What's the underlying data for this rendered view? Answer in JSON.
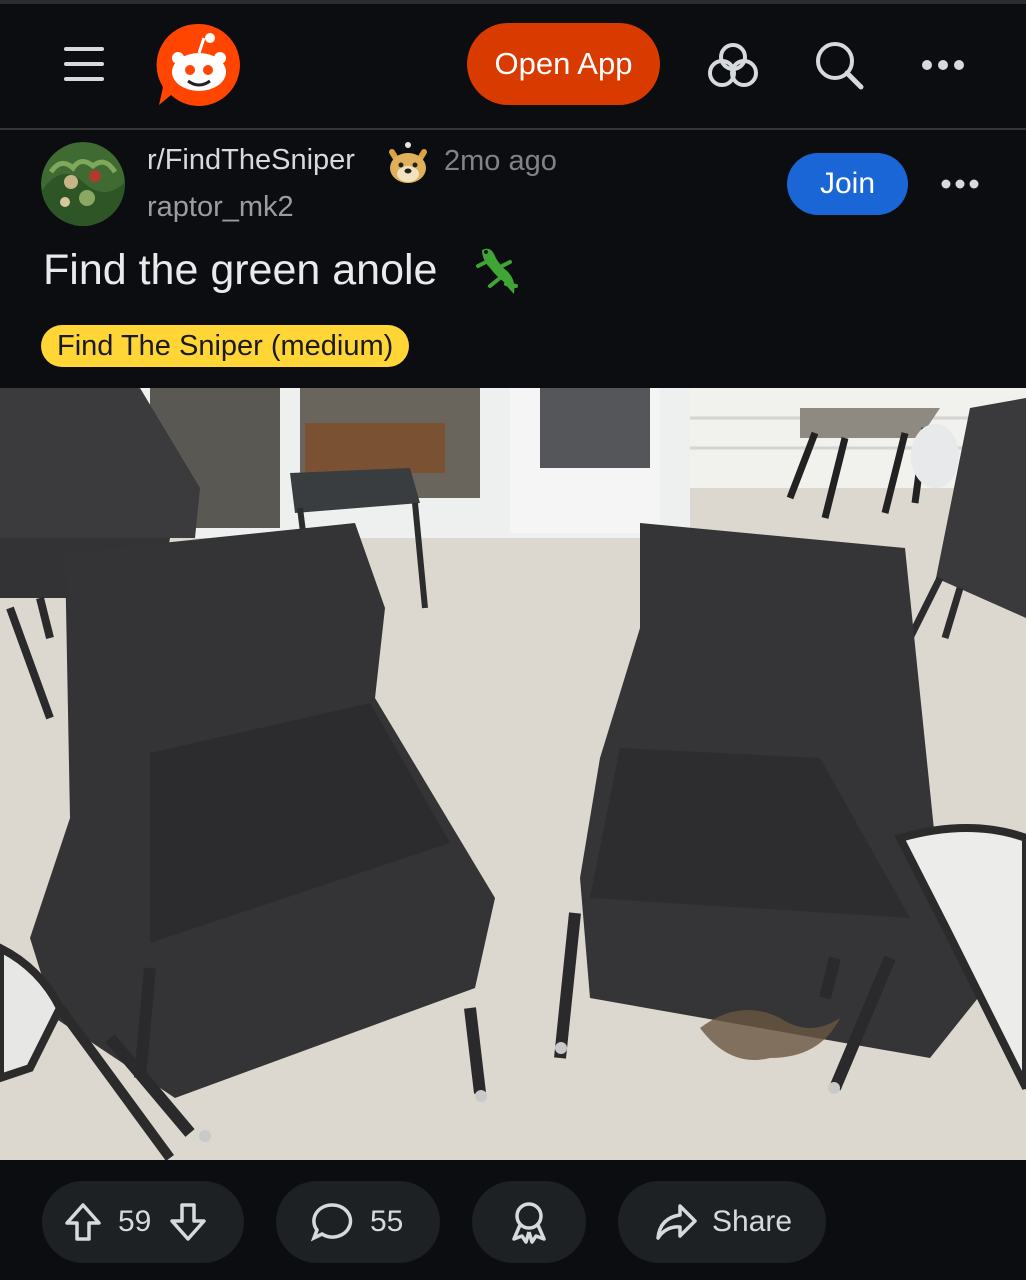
{
  "topbar": {
    "menu_icon": "hamburger-menu-icon",
    "logo_icon": "reddit-snoo-logo",
    "open_app_label": "Open App",
    "colors": {
      "open_app": "#d93a00",
      "logo": "#ff4500"
    }
  },
  "post": {
    "subreddit": "r/FindTheSniper",
    "time": "2mo ago",
    "author": "raptor_mk2",
    "join_label": "Join",
    "title": "Find the green anole",
    "title_emoji": "lizard",
    "flair": "Find The Sniper (medium)",
    "colors": {
      "join": "#1b66d6",
      "flair": "#ffd635"
    }
  },
  "image": {
    "description_icon": "patio-chairs-photo"
  },
  "actions": {
    "upvotes": "59",
    "comments": "55",
    "share_label": "Share"
  }
}
